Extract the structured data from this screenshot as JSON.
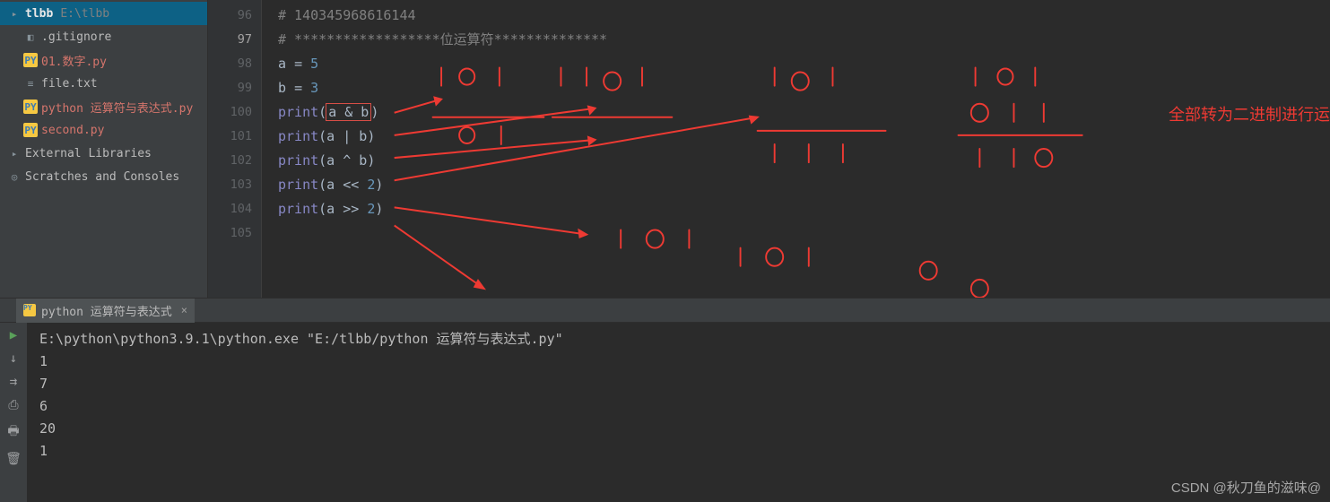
{
  "sidebar": {
    "project": {
      "name": "tlbb",
      "path": "E:\\tlbb"
    },
    "files": [
      {
        "label": ".gitignore",
        "icon": "file"
      },
      {
        "label": "01.数字.py",
        "icon": "py",
        "modified": true
      },
      {
        "label": "file.txt",
        "icon": "file"
      },
      {
        "label": "python 运算符与表达式.py",
        "icon": "py",
        "modified": true
      },
      {
        "label": "second.py",
        "icon": "py",
        "modified": true
      }
    ],
    "external": "External Libraries",
    "scratches": "Scratches and Consoles"
  },
  "gutter": [
    "96",
    "97",
    "98",
    "99",
    "100",
    "101",
    "102",
    "103",
    "104",
    "105"
  ],
  "code": {
    "l96": "# 140345968616144",
    "l97_prefix": "# ******************",
    "l97_mid": "位运算符",
    "l97_suffix": "**************",
    "l98_a": "a ",
    "l98_eq": "= ",
    "l98_v": "5",
    "l99_a": "b ",
    "l99_eq": "= ",
    "l99_v": "3",
    "l100_fn": "print",
    "l100_arg": "(a & b)",
    "l100_box": "a & b",
    "l101_fn": "print",
    "l101_arg": "(a | b)",
    "l102_fn": "print",
    "l102_arg": "(a ^ b)",
    "l103_fn": "print",
    "l103_open": "(a << ",
    "l103_num": "2",
    "l103_close": ")",
    "l104_fn": "print",
    "l104_open": "(a >> ",
    "l104_num": "2",
    "l104_close": ")"
  },
  "annotation_text": "全部转为二进制进行运",
  "terminal": {
    "tab_label": "python 运算符与表达式",
    "cmd_prefix": "E:\\python\\python3.9.1\\python.exe ",
    "cmd_path": "\"E:/tlbb/python 运算符与表达式.py\"",
    "out": [
      "1",
      "7",
      "6",
      "20",
      "1"
    ]
  },
  "watermark": "CSDN @秋刀鱼的滋味@"
}
